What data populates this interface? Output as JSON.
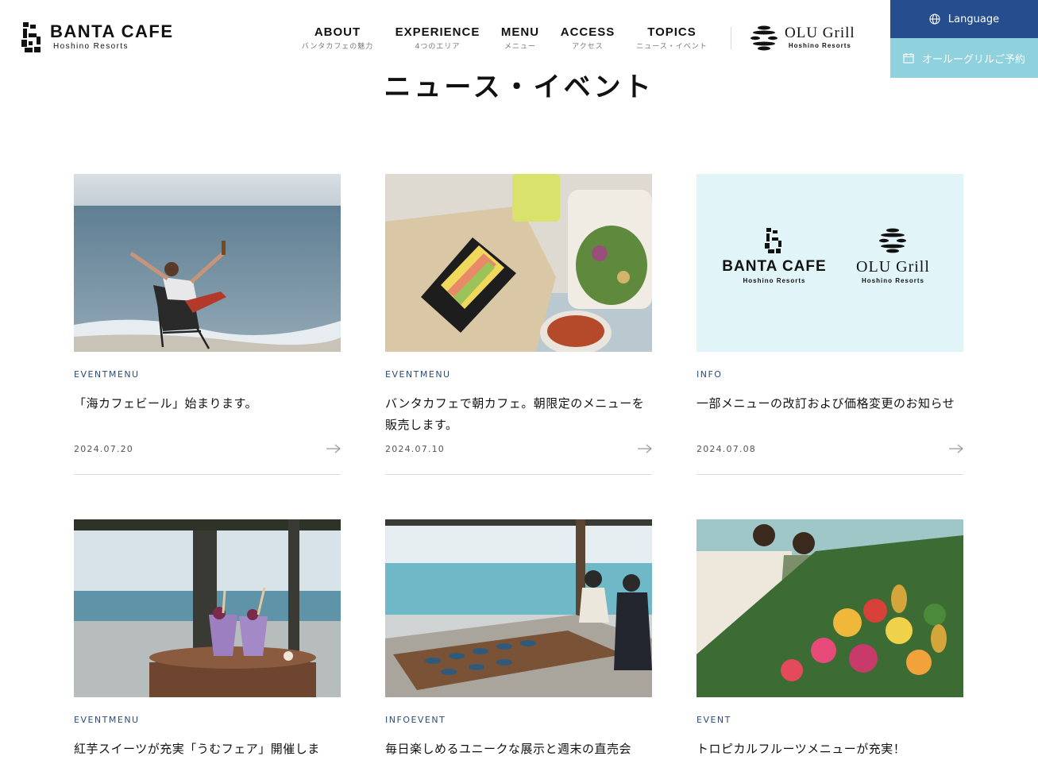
{
  "header": {
    "logo_title": "BANTA CAFE",
    "logo_sub": "Hoshino Resorts",
    "nav": [
      {
        "label": "ABOUT",
        "sub": "バンタカフェの魅力"
      },
      {
        "label": "EXPERIENCE",
        "sub": "4つのエリア"
      },
      {
        "label": "MENU",
        "sub": "メニュー"
      },
      {
        "label": "ACCESS",
        "sub": "アクセス"
      },
      {
        "label": "TOPICS",
        "sub": "ニュース・イベント"
      }
    ],
    "olu_title": "OLU Grill",
    "olu_sub": "Hoshino Resorts",
    "language_label": "Language",
    "reserve_label": "オールーグリルご予約"
  },
  "page_title": "ニュース・イベント",
  "cards": [
    {
      "category": "EVENTMENU",
      "title": "「海カフェビール」始まります。",
      "date": "2024.07.20",
      "image": "beach-chair-photo"
    },
    {
      "category": "EVENTMENU",
      "title": "バンタカフェで朝カフェ。朝限定のメニューを販売します。",
      "date": "2024.07.10",
      "image": "onigiri-breakfast-photo"
    },
    {
      "category": "INFO",
      "title": "一部メニューの改訂および価格変更のお知らせ",
      "date": "2024.07.08",
      "image": "logos-banner",
      "banner_logo_left": "BANTA CAFE",
      "banner_logo_right": "OLU Grill",
      "banner_sub": "Hoshino Resorts"
    },
    {
      "category": "EVENTMENU",
      "title": "紅芋スイーツが充実「うむフェア」開催しま",
      "date": "",
      "image": "purple-drinks-photo"
    },
    {
      "category": "INFOEVENT",
      "title": "毎日楽しめるユニークな展示と週末の直売会",
      "date": "",
      "image": "pottery-table-photo"
    },
    {
      "category": "EVENT",
      "title": "トロピカルフルーツメニューが充実！",
      "date": "",
      "image": "tropical-fruits-photo"
    }
  ],
  "colors": {
    "language_bg": "#264e8f",
    "reserve_bg": "#8fd1dc",
    "category_text": "#2b4b7a",
    "banner_bg": "#e1f4f7"
  }
}
